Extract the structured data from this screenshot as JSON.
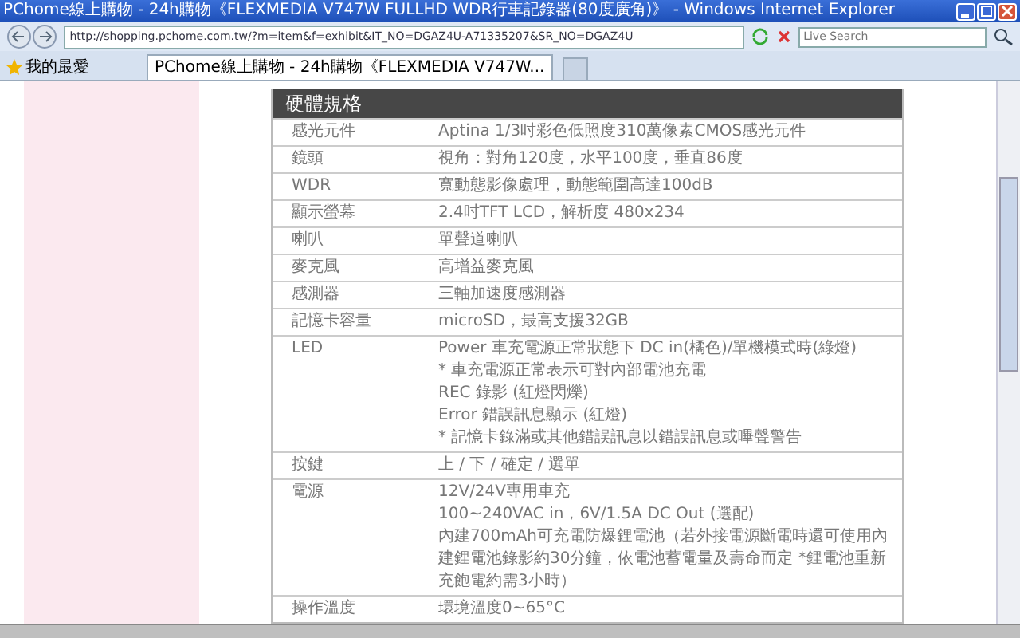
{
  "window": {
    "title": "PChome線上購物 - 24h購物《FLEXMEDIA V747W FULLHD WDR行車記錄器(80度廣角)》 - Windows Internet Explorer"
  },
  "address_bar": {
    "url": "http://shopping.pchome.com.tw/?m=item&f=exhibit&IT_NO=DGAZ4U-A71335207&SR_NO=DGAZ4U"
  },
  "search": {
    "placeholder": "Live Search"
  },
  "favorites": {
    "label": "我的最愛"
  },
  "tabs": [
    {
      "label": "PChome線上購物 - 24h購物《FLEXMEDIA V747W...",
      "selected": true
    }
  ],
  "spec_table": {
    "title": "硬體規格",
    "rows": [
      {
        "label": "感光元件",
        "lines": [
          "Aptina 1/3吋彩色低照度310萬像素CMOS感光元件"
        ]
      },
      {
        "label": "鏡頭",
        "lines": [
          "視角：對角120度，水平100度，垂直86度"
        ]
      },
      {
        "label": "WDR",
        "lines": [
          "寬動態影像處理，動態範圍高達100dB"
        ]
      },
      {
        "label": "顯示螢幕",
        "lines": [
          "2.4吋TFT LCD，解析度 480x234"
        ]
      },
      {
        "label": "喇叭",
        "lines": [
          "單聲道喇叭"
        ]
      },
      {
        "label": "麥克風",
        "lines": [
          "高增益麥克風"
        ]
      },
      {
        "label": "感測器",
        "lines": [
          "三軸加速度感測器"
        ]
      },
      {
        "label": "記憶卡容量",
        "lines": [
          "microSD，最高支援32GB"
        ]
      },
      {
        "label": "LED",
        "lines": [
          "Power 車充電源正常狀態下 DC in(橘色)/單機模式時(綠燈)",
          "* 車充電源正常表示可對內部電池充電",
          "REC 錄影 (紅燈閃爍)",
          "Error 錯誤訊息顯示 (紅燈)",
          "* 記憶卡錄滿或其他錯誤訊息以錯誤訊息或嗶聲警告"
        ]
      },
      {
        "label": "按鍵",
        "lines": [
          "上 / 下 / 確定 / 選單"
        ]
      },
      {
        "label": "電源",
        "lines": [
          "12V/24V專用車充",
          "100~240VAC in，6V/1.5A DC Out (選配)",
          "內建700mAh可充電防爆鋰電池（若外接電源斷電時還可使用內建鋰電池錄影約30分鐘，依電池蓄電量及壽命而定 *鋰電池重新充飽電約需3小時）"
        ]
      },
      {
        "label": "操作溫度",
        "lines": [
          "環境溫度0~65°C"
        ]
      }
    ]
  }
}
